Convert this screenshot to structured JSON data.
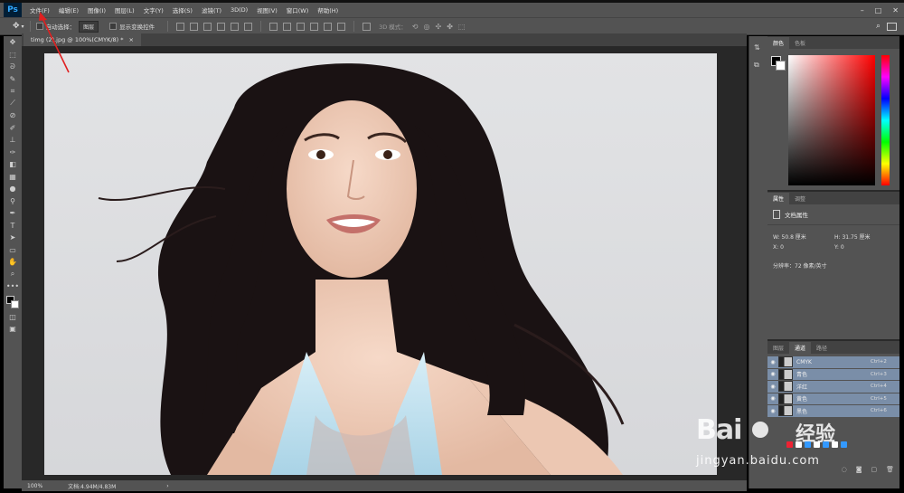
{
  "app": {
    "logo": "Ps"
  },
  "menu": [
    "文件(F)",
    "编辑(E)",
    "图像(I)",
    "图层(L)",
    "文字(Y)",
    "选择(S)",
    "滤镜(T)",
    "3D(D)",
    "视图(V)",
    "窗口(W)",
    "帮助(H)"
  ],
  "options": {
    "auto_select_label": "自动选择：",
    "auto_select_value": "图层",
    "show_transform_label": "显示变换控件",
    "mode_3d": "3D 模式："
  },
  "document": {
    "tab_title": "timg (2).jpg @ 100%(CMYK/8) *",
    "zoom": "100%",
    "doc_info": "文档:4.94M/4.83M"
  },
  "panels": {
    "color_tabs": [
      "颜色",
      "色板"
    ],
    "prop_tabs": [
      "属性",
      "调整"
    ],
    "prop_title": "文档属性",
    "w_label": "W:",
    "w_value": "50.8 厘米",
    "h_label": "H:",
    "h_value": "31.75 厘米",
    "x_label": "X:",
    "x_value": "0",
    "y_label": "Y:",
    "y_value": "0",
    "resolution": "分辨率：72 像素/英寸",
    "layer_tabs": [
      "图层",
      "通道",
      "路径"
    ],
    "channels": [
      {
        "name": "CMYK",
        "shortcut": "Ctrl+2"
      },
      {
        "name": "青色",
        "shortcut": "Ctrl+3"
      },
      {
        "name": "洋红",
        "shortcut": "Ctrl+4"
      },
      {
        "name": "黄色",
        "shortcut": "Ctrl+5"
      },
      {
        "name": "黑色",
        "shortcut": "Ctrl+6"
      }
    ]
  },
  "watermark": {
    "brand": "Bai",
    "brand2": "经验",
    "url": "jingyan.baidu.com"
  },
  "colors": {
    "ps_blue": "#31a8ff",
    "annotation_red": "#e02020"
  }
}
